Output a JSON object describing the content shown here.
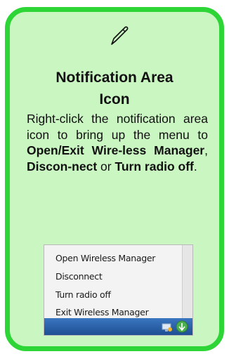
{
  "card": {
    "title_line1": "Notification Area",
    "title_line2": "Icon",
    "icon": "pen-icon",
    "body": {
      "t1": "Right-click the notification area icon to bring up the menu to ",
      "b1": "Open/Exit Wire-less Manager",
      "t2": ", ",
      "b2": "Discon-nect",
      "t3": " or ",
      "b3": "Turn radio off",
      "t4": "."
    }
  },
  "screenshot": {
    "menu_items": [
      "Open Wireless Manager",
      "Disconnect",
      "Turn radio off",
      "Exit Wireless Manager"
    ]
  },
  "colors": {
    "card_background": "#caf6c2",
    "card_border": "#2dd636"
  }
}
